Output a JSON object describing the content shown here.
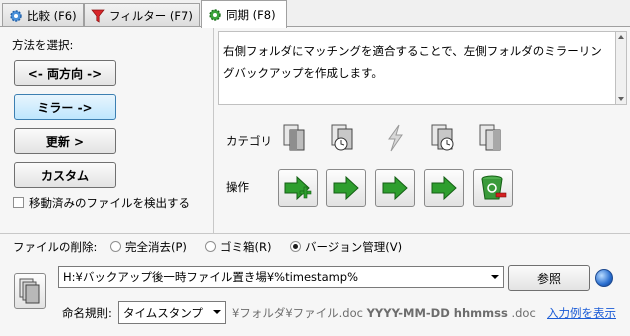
{
  "tabs": [
    {
      "label": "比較 (F6)",
      "icon": "gear-blue-icon"
    },
    {
      "label": "フィルター (F7)",
      "icon": "filter-icon"
    },
    {
      "label": "同期 (F8)",
      "icon": "gear-green-icon",
      "active": true
    }
  ],
  "left": {
    "method_label": "方法を選択:",
    "buttons": [
      "<- 両方向 ->",
      "ミラー ->",
      "更新 >",
      "カスタム"
    ],
    "selected_index": 1,
    "detect_moved_label": "移動済みのファイルを検出する",
    "detect_moved_checked": false
  },
  "description": {
    "line1": "右側フォルダにマッチングを適合することで、左側フォルダのミラーリン",
    "line2": "グバックアップを作成します。"
  },
  "category": {
    "label": "カテゴリ",
    "icons": [
      "file-left-only-icon",
      "file-left-newer-icon",
      "file-different-icon",
      "file-right-newer-icon",
      "file-right-only-icon"
    ]
  },
  "action": {
    "label": "操作",
    "icons": [
      "create-right-icon",
      "update-right-icon",
      "update-right-icon",
      "update-right-icon",
      "delete-right-icon"
    ]
  },
  "deletion": {
    "label": "ファイルの削除:",
    "options": [
      "完全消去(P)",
      "ゴミ箱(R)",
      "バージョン管理(V)"
    ],
    "selected_index": 2
  },
  "versioning": {
    "path": "H:¥バックアップ後一時ファイル置き場¥%timestamp%",
    "browse_label": "参照",
    "naming_label": "命名規則:",
    "naming_value": "タイムスタンプ",
    "example_prefix": "¥フォルダ¥ファイル.doc",
    "example_bold": "YYYY-MM-DD hhmmss",
    "example_suffix": ".doc",
    "show_example_link": "入力例を表示"
  },
  "colors": {
    "accent_blue": "#3c7fb1",
    "link": "#1a5bd6",
    "green_arrow": "#2e9e2e"
  }
}
